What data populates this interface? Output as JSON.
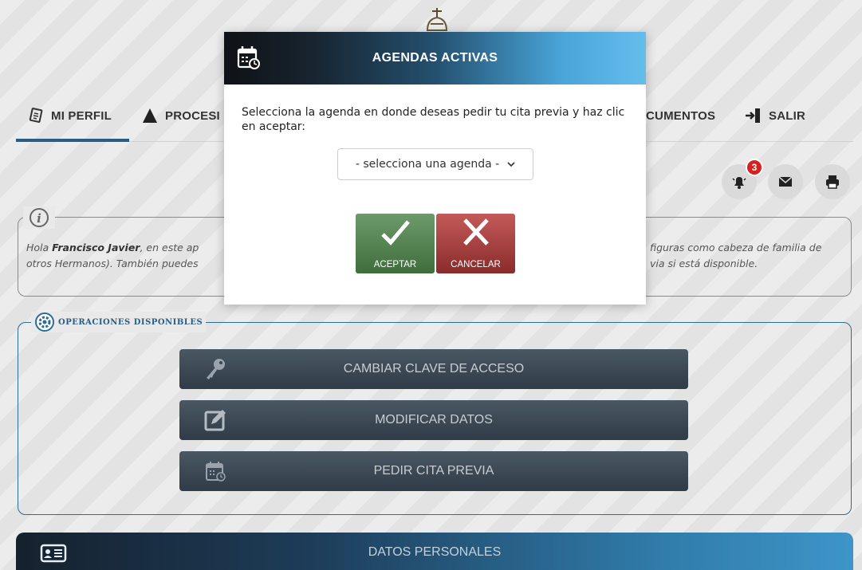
{
  "nav": {
    "items": [
      {
        "label": "MI PERFIL",
        "icon": "id-card-icon"
      },
      {
        "label": "PROCESI",
        "icon": "procession-icon"
      },
      {
        "label": "CUMENTOS",
        "icon": "documents-icon"
      },
      {
        "label": "SALIR",
        "icon": "logout-icon"
      }
    ]
  },
  "actions": {
    "notifications_count": "3"
  },
  "info": {
    "greeting_prefix": "Hola ",
    "name": "Francisco Javier",
    "text_left_1": ", en este ap",
    "text_left_2": "otros Hermanos). También puedes ",
    "text_right_1": "figuras como cabeza de familia de",
    "text_right_2": "via si está disponible."
  },
  "operations": {
    "legend": "OPERACIONES DISPONIBLES",
    "buttons": [
      {
        "label": "CAMBIAR CLAVE DE ACCESO",
        "icon": "key-icon"
      },
      {
        "label": "MODIFICAR DATOS",
        "icon": "edit-icon"
      },
      {
        "label": "PEDIR CITA PREVIA",
        "icon": "calendar-icon"
      }
    ]
  },
  "datos": {
    "label": "DATOS PERSONALES"
  },
  "modal": {
    "title": "AGENDAS ACTIVAS",
    "text": "Selecciona la agenda en donde deseas pedir tu cita previa y haz clic en aceptar:",
    "select_value": "- selecciona una agenda -",
    "accept_label": "ACEPTAR",
    "cancel_label": "CANCELAR"
  },
  "colors": {
    "accept": "#4f7f4c",
    "cancel": "#9e3434",
    "nav_underline": "#2a5d84",
    "op_button": "#3a4754"
  }
}
